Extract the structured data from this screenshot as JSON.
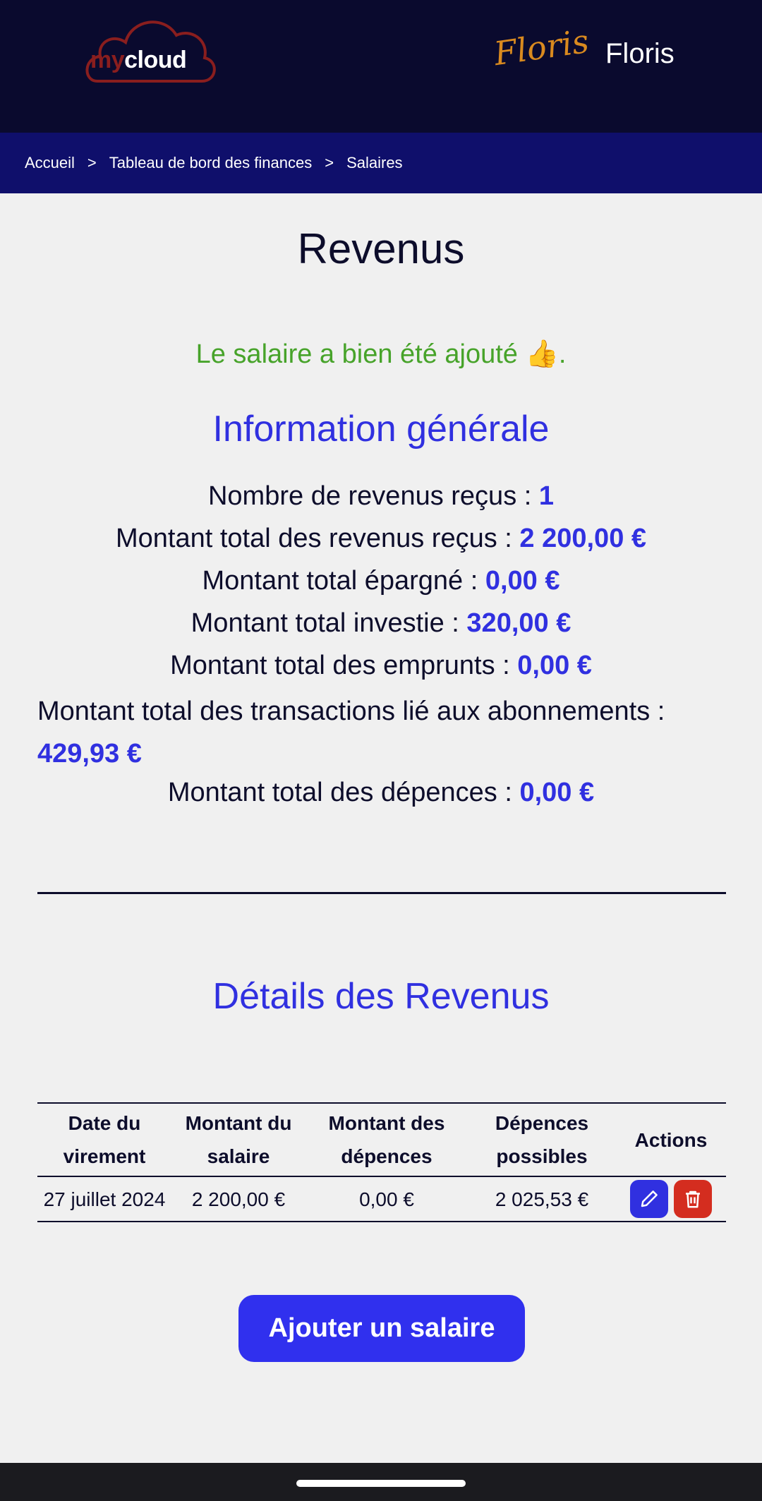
{
  "header": {
    "logo_my": "my",
    "logo_cloud": "cloud",
    "signature": "Floris",
    "user_name": "Floris"
  },
  "breadcrumb": {
    "items": [
      "Accueil",
      "Tableau de bord des finances",
      "Salaires"
    ],
    "separator": ">"
  },
  "page": {
    "title": "Revenus",
    "success_message": "Le salaire a bien été ajouté 👍."
  },
  "general_info": {
    "title": "Information générale",
    "lines": [
      {
        "label": "Nombre de revenus reçus : ",
        "value": "1"
      },
      {
        "label": "Montant total des revenus reçus : ",
        "value": "2 200,00 €"
      },
      {
        "label": "Montant total épargné : ",
        "value": "0,00 €"
      },
      {
        "label": "Montant total investie : ",
        "value": "320,00 €"
      },
      {
        "label": "Montant total des emprunts : ",
        "value": "0,00 €"
      },
      {
        "label": "Montant total des transactions lié aux abonnements : ",
        "value": "429,93 €"
      },
      {
        "label": "Montant total des dépences : ",
        "value": "0,00 €"
      }
    ]
  },
  "details": {
    "title": "Détails des Revenus",
    "columns": [
      "Date du virement",
      "Montant du salaire",
      "Montant des dépences",
      "Dépences possibles",
      "Actions"
    ],
    "rows": [
      {
        "date": "27 juillet 2024",
        "salary": "2 200,00 €",
        "expenses": "0,00 €",
        "possible": "2 025,53 €"
      }
    ],
    "add_button": "Ajouter un salaire"
  },
  "icons": {
    "edit": "edit-icon",
    "delete": "trash-icon"
  },
  "colors": {
    "header_bg": "#0a0a2e",
    "breadcrumb_bg": "#0f0f6b",
    "accent": "#3030e0",
    "success": "#47a32a",
    "danger": "#d42d1f"
  }
}
